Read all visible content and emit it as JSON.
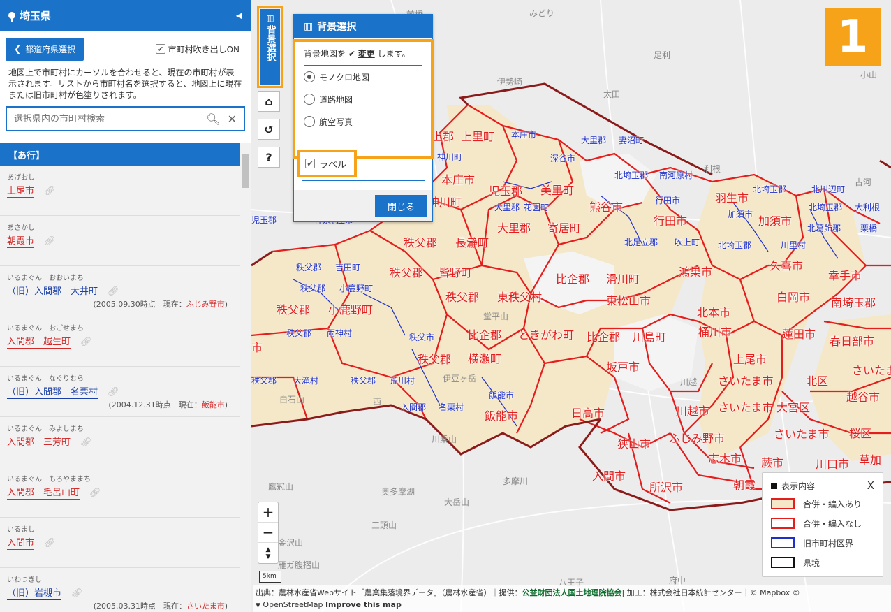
{
  "sidebar": {
    "title": "埼玉県",
    "collapse_icon": "triangle-left-icon",
    "pref_button": "都道府県選択",
    "balloon_label": "市町村吹き出しON",
    "description": "地図上で市町村にカーソルを合わせると、現在の市町村が表示されます。リストから市町村名を選択すると、地図上に現在または旧市町村が色塗りされます。",
    "search_placeholder": "選択県内の市町村検索",
    "group_header": "【あ行】",
    "items": [
      {
        "kana": "あげおし",
        "name": "上尾市",
        "color": "red",
        "note": ""
      },
      {
        "kana": "あさかし",
        "name": "朝霞市",
        "color": "red",
        "note": ""
      },
      {
        "kana": "いるまぐん　おおいまち",
        "name": "（旧）入間郡　大井町",
        "color": "blue",
        "note_date": "(2005.09.30時点",
        "note_now": "現在：",
        "note_city": "ふじみ野市",
        "note_end": ")"
      },
      {
        "kana": "いるまぐん　おごせまち",
        "name": "入間郡　越生町",
        "color": "red",
        "note": ""
      },
      {
        "kana": "いるまぐん　なぐりむら",
        "name": "（旧）入間郡　名栗村",
        "color": "blue",
        "note_date": "(2004.12.31時点",
        "note_now": "現在：",
        "note_city": "飯能市",
        "note_end": ")"
      },
      {
        "kana": "いるまぐん　みよしまち",
        "name": "入間郡　三芳町",
        "color": "red",
        "note": ""
      },
      {
        "kana": "いるまぐん　もろやままち",
        "name": "入間郡　毛呂山町",
        "color": "red",
        "note": ""
      },
      {
        "kana": "いるまし",
        "name": "入間市",
        "color": "red",
        "note": ""
      },
      {
        "kana": "いわつきし",
        "name": "（旧）岩槻市",
        "color": "blue",
        "note_date": "(2005.03.31時点",
        "note_now": "現在：",
        "note_city": "さいたま市",
        "note_end": ")"
      }
    ]
  },
  "map_controls": {
    "bg_button": "背景選択",
    "home_icon": "home-icon",
    "reset_icon": "reset-icon",
    "help_label": "?",
    "zoom_in": "+",
    "zoom_out": "−",
    "compass": "▲▼",
    "scale": "5km"
  },
  "bg_panel": {
    "title": "背景選択",
    "desc_pre": "背景地図を",
    "desc_bold": "変更",
    "desc_post": "します。",
    "options": [
      "モノクロ地図",
      "道路地図",
      "航空写真"
    ],
    "selected": "モノクロ地図",
    "label_option": "ラベル",
    "close": "閉じる"
  },
  "badge": "1",
  "legend": {
    "title": "表示内容",
    "close": "X",
    "items": [
      {
        "label": "合併・編入あり",
        "border": "#e41d1d",
        "fill": "#f5e8c8"
      },
      {
        "label": "合併・編入なし",
        "border": "#e41d1d",
        "fill": "#ffffff"
      },
      {
        "label": "旧市町村区界",
        "border": "#1e30c8",
        "fill": "#ffffff"
      },
      {
        "label": "県境",
        "border": "#111111",
        "fill": "#ffffff"
      }
    ]
  },
  "attribution": {
    "line1_a": "出典：農林水産省Webサイト「農業集落境界データ」（農林水産省）｜提供：",
    "line1_green": "公益財団法人国土地理院協会",
    "line1_b": "| 加工：株式会社日本統計センター｜© Mapbox ©",
    "line2": "OpenStreetMap",
    "line2_b": "Improve this map"
  },
  "map_labels": {
    "red": [
      {
        "t": "上里町"
      },
      {
        "t": "本庄市"
      },
      {
        "t": "児玉郡"
      },
      {
        "t": "美里町"
      },
      {
        "t": "熊谷市"
      },
      {
        "t": "羽生市"
      },
      {
        "t": "加須市"
      },
      {
        "t": "神川町"
      },
      {
        "t": "大里郡"
      },
      {
        "t": "寄居町"
      },
      {
        "t": "行田市"
      },
      {
        "t": "秩父郡"
      },
      {
        "t": "長瀞町"
      },
      {
        "t": "鴻巣市"
      },
      {
        "t": "久喜市"
      },
      {
        "t": "秩父郡"
      },
      {
        "t": "皆野町"
      },
      {
        "t": "比企郡"
      },
      {
        "t": "滑川町"
      },
      {
        "t": "幸手市"
      },
      {
        "t": "秩父郡"
      },
      {
        "t": "東秩父村"
      },
      {
        "t": "東松山市"
      },
      {
        "t": "白岡市"
      },
      {
        "t": "南埼玉郡"
      },
      {
        "t": "秩父郡"
      },
      {
        "t": "小鹿野町"
      },
      {
        "t": "北本市"
      },
      {
        "t": "桶川市"
      },
      {
        "t": "比企郡"
      },
      {
        "t": "ときがわ町"
      },
      {
        "t": "比企郡"
      },
      {
        "t": "川島町"
      },
      {
        "t": "蓮田市"
      },
      {
        "t": "春日部市"
      },
      {
        "t": "秩父郡"
      },
      {
        "t": "横瀬町"
      },
      {
        "t": "坂戸市"
      },
      {
        "t": "上尾市"
      },
      {
        "t": "さいたま市"
      },
      {
        "t": "さいたま市"
      },
      {
        "t": "北区"
      },
      {
        "t": "越谷市"
      },
      {
        "t": "飯能市"
      },
      {
        "t": "日高市"
      },
      {
        "t": "川越市"
      },
      {
        "t": "さいたま市"
      },
      {
        "t": "大宮区"
      },
      {
        "t": "狭山市"
      },
      {
        "t": "ふじみ野市"
      },
      {
        "t": "さいたま市"
      },
      {
        "t": "桜区"
      },
      {
        "t": "志木市"
      },
      {
        "t": "蕨市"
      },
      {
        "t": "川口市"
      },
      {
        "t": "草加"
      },
      {
        "t": "入間市"
      },
      {
        "t": "所沢市"
      },
      {
        "t": "朝霞"
      },
      {
        "t": "市"
      },
      {
        "t": "秩父郡"
      },
      {
        "t": "上郡"
      }
    ],
    "blue": [
      {
        "t": "本庄市"
      },
      {
        "t": "大里郡"
      },
      {
        "t": "妻沼町"
      },
      {
        "t": "神川町"
      },
      {
        "t": "深谷市"
      },
      {
        "t": "北埼玉郡"
      },
      {
        "t": "南河原村"
      },
      {
        "t": "北埼玉郡"
      },
      {
        "t": "北川辺町"
      },
      {
        "t": "行田市"
      },
      {
        "t": "大里郡"
      },
      {
        "t": "花園町"
      },
      {
        "t": "加須市"
      },
      {
        "t": "北埼玉郡"
      },
      {
        "t": "大利根"
      },
      {
        "t": "北足立郡"
      },
      {
        "t": "吹上町"
      },
      {
        "t": "北埼玉郡"
      },
      {
        "t": "川里村"
      },
      {
        "t": "北葛飾郡"
      },
      {
        "t": "栗橋"
      },
      {
        "t": "秩父郡"
      },
      {
        "t": "吉田町"
      },
      {
        "t": "秩父郡"
      },
      {
        "t": "小鹿野町"
      },
      {
        "t": "秩父郡"
      },
      {
        "t": "両神村"
      },
      {
        "t": "秩父市"
      },
      {
        "t": "秩父郡"
      },
      {
        "t": "大滝村"
      },
      {
        "t": "秩父郡"
      },
      {
        "t": "荒川村"
      },
      {
        "t": "入間郡"
      },
      {
        "t": "名栗村"
      },
      {
        "t": "飯能市"
      },
      {
        "t": "児玉郡"
      },
      {
        "t": "神泉村"
      },
      {
        "t": "本庄市"
      }
    ],
    "gray": [
      {
        "t": "前橋"
      },
      {
        "t": "みどり"
      },
      {
        "t": "足利"
      },
      {
        "t": "伊勢崎"
      },
      {
        "t": "太田"
      },
      {
        "t": "小山"
      },
      {
        "t": "古河"
      },
      {
        "t": "利根"
      },
      {
        "t": "川越"
      },
      {
        "t": "伊豆ヶ岳"
      },
      {
        "t": "白石山"
      },
      {
        "t": "西"
      },
      {
        "t": "川乗山"
      },
      {
        "t": "多摩川"
      },
      {
        "t": "奥多摩湖"
      },
      {
        "t": "大岳山"
      },
      {
        "t": "鷹冠山"
      },
      {
        "t": "三頭山"
      },
      {
        "t": "金沢山"
      },
      {
        "t": "雁ガ腹摺山"
      },
      {
        "t": "八王子"
      },
      {
        "t": "府中"
      },
      {
        "t": "堂平山"
      }
    ]
  }
}
